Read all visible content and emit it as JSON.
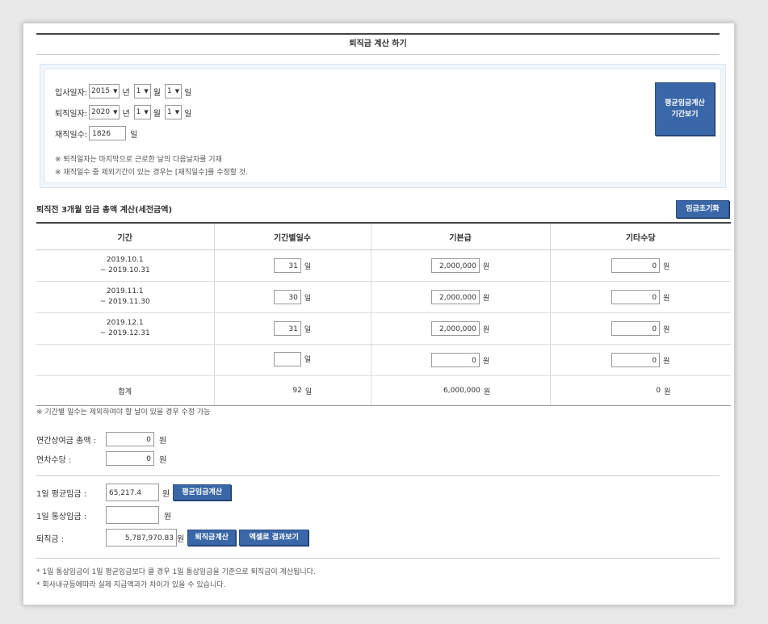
{
  "title": "퇴직금 계산 하기",
  "dates": {
    "hire_label": "입사일자:",
    "hire_year": "2015",
    "hire_month": "1",
    "hire_day": "1",
    "retire_label": "퇴직일자:",
    "retire_year": "2020",
    "retire_month": "1",
    "retire_day": "1",
    "unit_year": "년",
    "unit_month": "월",
    "unit_day": "일",
    "tenure_label": "재직일수:",
    "tenure_value": "1826",
    "tenure_unit": "일",
    "note1": "※ 퇴직일자는 마지막으로 근로한 날의 다음날자를 기재",
    "note2": "※ 재직일수 중 제외기간이 있는 경우는 [재직일수]를 수정할 것.",
    "avg_period_button_line1": "평균임금계산",
    "avg_period_button_line2": "기간보기"
  },
  "wage_section": {
    "title": "퇴직전 3개월 임금 총액 계산(세전금액)",
    "reset_button": "임금초기화",
    "columns": [
      "기간",
      "기간별일수",
      "기본급",
      "기타수당"
    ],
    "rows": [
      {
        "period_start": "2019.10.1",
        "period_end": "~ 2019.10.31",
        "days": "31",
        "base": "2,000,000",
        "other": "0"
      },
      {
        "period_start": "2019.11.1",
        "period_end": "~ 2019.11.30",
        "days": "30",
        "base": "2,000,000",
        "other": "0"
      },
      {
        "period_start": "2019.12.1",
        "period_end": "~ 2019.12.31",
        "days": "31",
        "base": "2,000,000",
        "other": "0"
      },
      {
        "period_start": "",
        "period_end": "",
        "days": "",
        "base": "0",
        "other": "0"
      }
    ],
    "unit_day": "일",
    "unit_won": "원",
    "sum_label": "합계",
    "sum_days": "92",
    "sum_base": "6,000,000",
    "sum_other": "0",
    "note": "※ 기간별 일수는 제외하여야 할 날이 있을 경우 수정 가능"
  },
  "bonus": {
    "annual_bonus_label": "연간상여금 총액 :",
    "annual_bonus_value": "0",
    "leave_pay_label": "연차수당 :",
    "leave_pay_value": "0",
    "unit_won": "원"
  },
  "result": {
    "avg_wage_label": "1일 평균임금 :",
    "avg_wage_value": "65,217.4",
    "avg_wage_button": "평균임금계산",
    "normal_wage_label": "1일 통상임금 :",
    "normal_wage_value": "",
    "severance_label": "퇴직금 :",
    "severance_value": "5,787,970.83",
    "severance_button": "퇴직금계산",
    "excel_button": "엑셀로 결과보기",
    "unit_won": "원",
    "footnote1": "* 1일 통상임금이 1일 평균임금보다 클 경우 1일 통상임금을 기준으로 퇴직금이 계산됩니다.",
    "footnote2": "* 회사내규등에따라 실제 지급액과가 차이가 있을 수 있습니다."
  }
}
